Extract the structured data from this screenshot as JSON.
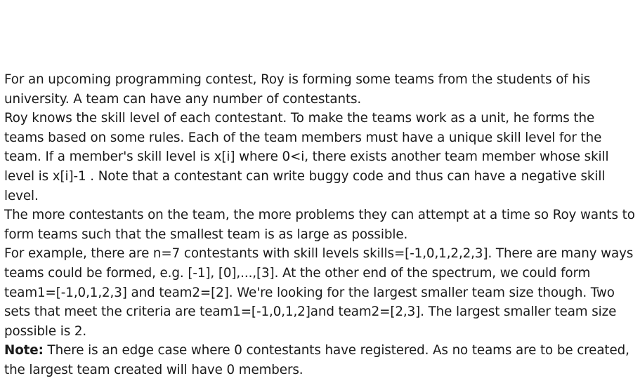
{
  "problem": {
    "paragraphs": [
      "For an upcoming programming contest, Roy is forming some teams from the students of his university. A team can have any number of contestants.",
      "Roy knows the skill level of each contestant. To make the teams work as a unit, he forms the teams based on some rules. Each of the team members must have a unique skill level for the team. If a member's skill level is x[i] where 0<i, there exists another team member whose skill level is x[i]-1 . Note that a contestant can write buggy code and thus can have a negative skill level.",
      "The more contestants on the team, the more problems they can attempt at a time so Roy wants to form teams such that the smallest team is as large as possible.",
      "For example, there are n=7 contestants with skill levels skills=[-1,0,1,2,2,3]. There are many ways teams could be formed, e.g. [-1], [0],...,[3]. At the other end of the spectrum, we could form team1=[-1,0,1,2,3] and team2=[2]. We're looking for the largest smaller team size though. Two sets that meet the criteria are  team1=[-1,0,1,2]and team2=[2,3]. The largest smaller team size possible is 2."
    ],
    "note_label": "Note:",
    "note_text": " There is an edge case where 0 contestants have registered. As no teams are to be created, the largest team created will have 0 members."
  }
}
